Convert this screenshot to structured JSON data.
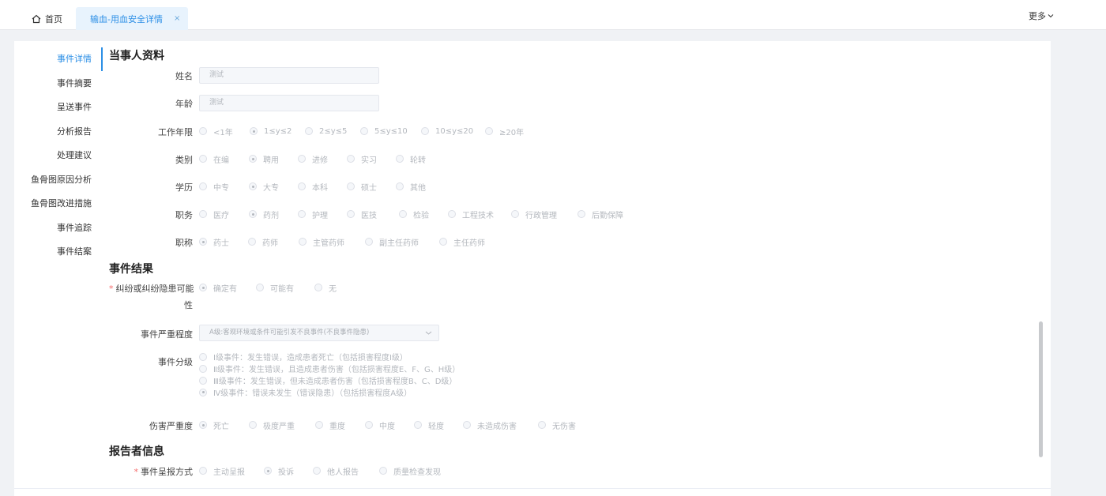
{
  "tabs": {
    "home": "首页",
    "active": "输血-用血安全详情",
    "close": "×",
    "more": "更多"
  },
  "nav": [
    "事件详情",
    "事件摘要",
    "呈送事件",
    "分析报告",
    "处理建议",
    "鱼骨图原因分析",
    "鱼骨图改进措施",
    "事件追踪",
    "事件结案"
  ],
  "section1": {
    "title": "当事人资料",
    "name_label": "姓名",
    "name_value": "测试",
    "age_label": "年龄",
    "age_value": "测试",
    "years_label": "工作年限",
    "years_options": [
      "<1年",
      "1≤y≤2",
      "2≤y≤5",
      "5≤y≤10",
      "10≤y≤20",
      "≥20年"
    ],
    "category_label": "类别",
    "category_options": [
      "在编",
      "聘用",
      "进修",
      "实习",
      "轮转"
    ],
    "edu_label": "学历",
    "edu_options": [
      "中专",
      "大专",
      "本科",
      "硕士",
      "其他"
    ],
    "duty_label": "职务",
    "duty_options": [
      "医疗",
      "药剂",
      "护理",
      "医技",
      "检验",
      "工程技术",
      "行政管理",
      "后勤保障"
    ],
    "title_label": "职称",
    "title_options": [
      "药士",
      "药师",
      "主管药师",
      "副主任药师",
      "主任药师"
    ]
  },
  "section2": {
    "title": "事件结果",
    "dispute_label_1": "纠纷或纠纷隐患可能",
    "dispute_label_2": "性",
    "dispute_options": [
      "确定有",
      "可能有",
      "无"
    ],
    "severity_label": "事件严重程度",
    "severity_value": "A级:客观环境或条件可能引发不良事件(不良事件隐患)",
    "grade_label": "事件分级",
    "grade_options": [
      "Ⅰ级事件：发生错误，造成患者死亡（包括损害程度Ⅰ级）",
      "Ⅱ级事件：发生错误，且造成患者伤害（包括损害程度E、F、G、H级）",
      "Ⅲ级事件：发生错误，但未造成患者伤害（包括损害程度B、C、D级）",
      "Ⅳ级事件：错误未发生（错误隐患）（包括损害程度A级）"
    ],
    "harm_label": "伤害严重度",
    "harm_options": [
      "死亡",
      "极度严重",
      "重度",
      "中度",
      "轻度",
      "未造成伤害",
      "无伤害"
    ]
  },
  "section3": {
    "title": "报告者信息",
    "report_label": "事件呈报方式",
    "report_options": [
      "主动呈报",
      "投诉",
      "他人报告",
      "质量检查发现"
    ]
  }
}
